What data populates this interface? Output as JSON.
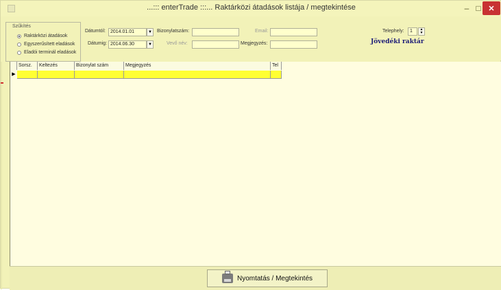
{
  "window": {
    "title": "...::: enterTrade :::... Raktárközi átadások listája / megtekintése",
    "buttons": {
      "minimize": "–",
      "maximize": "□",
      "close": "✕"
    }
  },
  "filter": {
    "group_label": "Szűkítés",
    "options": [
      "Raktárközi átadások",
      "Egyszerűsített eladások",
      "Eladói terminál eladások"
    ],
    "selected_index": 0,
    "date_from_label": "Dátumtól:",
    "date_from_value": "2014.01.01",
    "date_to_label": "Dátumig:",
    "date_to_value": "2014.06.30",
    "doc_number_label": "Bizonylatszám:",
    "customer_name_label": "Vevő név:",
    "email_label": "Email:",
    "note_label": "Megjegyzés:",
    "site_label": "Telephely:",
    "site_value": "1",
    "warehouse_name": "Jövedéki raktár"
  },
  "grid": {
    "columns": [
      "Sorsz.",
      "Keltezés",
      "Bizonylat szám",
      "Megjegyzés",
      "Tel"
    ]
  },
  "footer": {
    "print_button_label": "Nyomtatás / Megtekintés"
  }
}
